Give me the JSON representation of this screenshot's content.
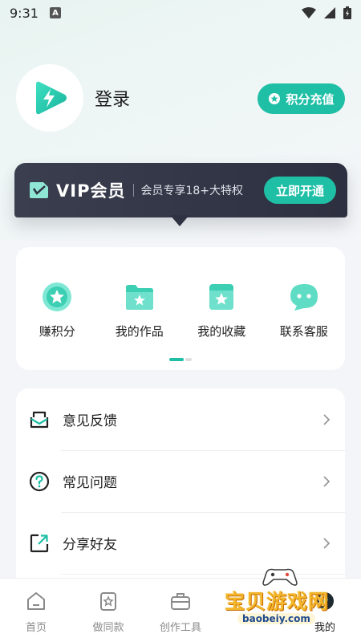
{
  "status_bar": {
    "time": "9:31",
    "badge": "A"
  },
  "profile": {
    "login_label": "登录"
  },
  "points_button": {
    "label": "积分充值"
  },
  "vip": {
    "title": "VIP会员",
    "description": "会员专享18+大特权",
    "cta": "立即开通"
  },
  "grid": {
    "items": [
      {
        "label": "赚积分",
        "icon": "coin-star-icon"
      },
      {
        "label": "我的作品",
        "icon": "folder-star-icon"
      },
      {
        "label": "我的收藏",
        "icon": "bookmark-star-icon"
      },
      {
        "label": "联系客服",
        "icon": "chat-bubble-icon"
      }
    ]
  },
  "list": {
    "items": [
      {
        "label": "意见反馈",
        "icon": "feedback-icon"
      },
      {
        "label": "常见问题",
        "icon": "question-icon"
      },
      {
        "label": "分享好友",
        "icon": "share-icon"
      }
    ]
  },
  "tabs": [
    {
      "label": "首页",
      "icon": "home-icon"
    },
    {
      "label": "做同款",
      "icon": "template-icon"
    },
    {
      "label": "创作工具",
      "icon": "toolbox-icon"
    },
    {
      "label": "",
      "icon": ""
    },
    {
      "label": "我的",
      "icon": "profile-icon"
    }
  ],
  "watermark": {
    "title": "宝贝游戏网",
    "url": "baobeiy.com"
  },
  "colors": {
    "accent": "#1fbfa6",
    "vip_bg": "#30333f",
    "page_bg": "#f4f5f8"
  }
}
